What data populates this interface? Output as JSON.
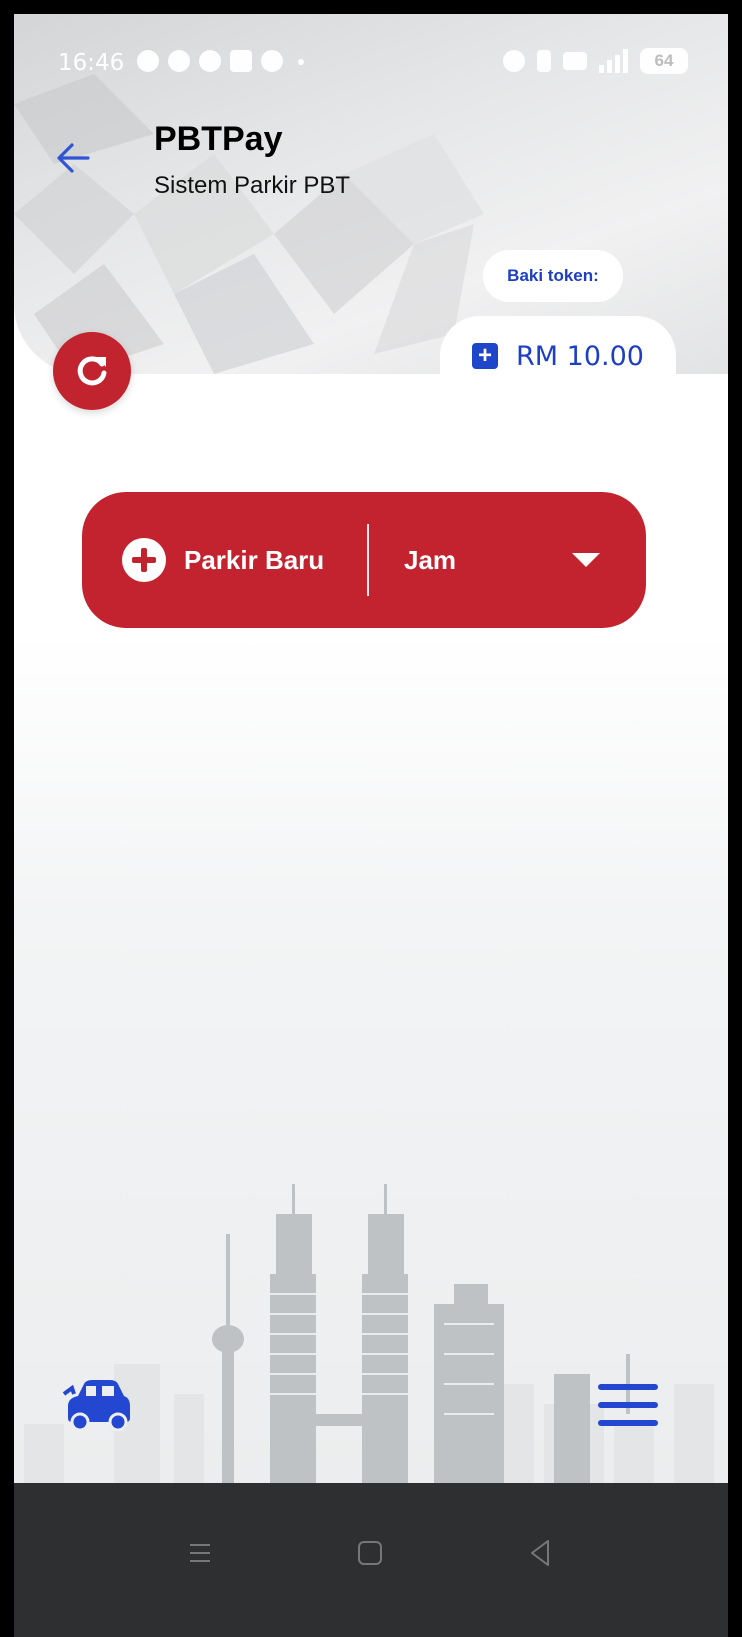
{
  "status_bar": {
    "time": "16:46",
    "battery": "64"
  },
  "header": {
    "title": "PBTPay",
    "subtitle": "Sistem Parkir PBT"
  },
  "token": {
    "label": "Baki token:",
    "amount": "RM 10.00"
  },
  "parking": {
    "new_label": "Parkir Baru",
    "unit_selected": "Jam"
  },
  "icons": {
    "back": "arrow-left-icon",
    "refresh": "refresh-icon",
    "add_token": "plus-square-icon",
    "add_parking": "plus-circle-icon",
    "dropdown": "caret-down-icon",
    "car": "car-icon",
    "menu": "hamburger-menu-icon"
  },
  "colors": {
    "primary_red": "#c2232e",
    "accent_blue": "#1f45c9"
  }
}
